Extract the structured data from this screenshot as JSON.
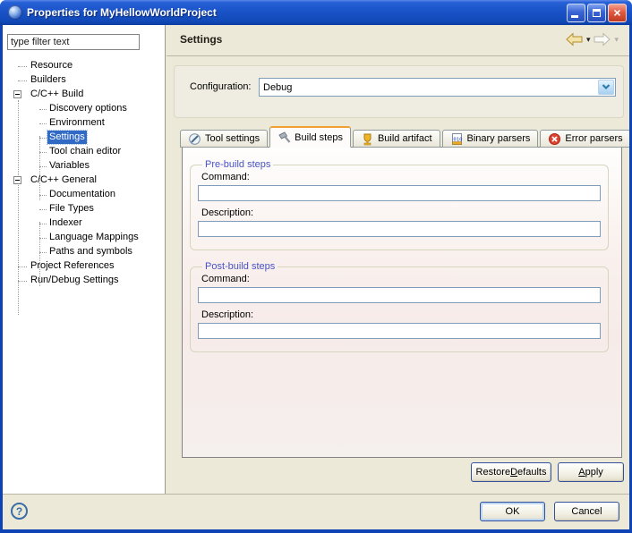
{
  "window": {
    "title": "Properties for MyHellowWorldProject",
    "close_glyph": "×"
  },
  "sidebar": {
    "filter_value": "type filter text",
    "tree": [
      {
        "label": "Resource",
        "level": 0
      },
      {
        "label": "Builders",
        "level": 0
      },
      {
        "label": "C/C++ Build",
        "level": 0,
        "expanded": true
      },
      {
        "label": "Discovery options",
        "level": 1
      },
      {
        "label": "Environment",
        "level": 1
      },
      {
        "label": "Settings",
        "level": 1,
        "selected": true
      },
      {
        "label": "Tool chain editor",
        "level": 1
      },
      {
        "label": "Variables",
        "level": 1
      },
      {
        "label": "C/C++ General",
        "level": 0,
        "expanded": true
      },
      {
        "label": "Documentation",
        "level": 1
      },
      {
        "label": "File Types",
        "level": 1
      },
      {
        "label": "Indexer",
        "level": 1
      },
      {
        "label": "Language Mappings",
        "level": 1
      },
      {
        "label": "Paths and symbols",
        "level": 1
      },
      {
        "label": "Project References",
        "level": 0
      },
      {
        "label": "Run/Debug Settings",
        "level": 0
      }
    ]
  },
  "header": {
    "title": "Settings",
    "back_icon": "back-arrow",
    "forward_icon": "forward-arrow",
    "menu_glyph": "▾"
  },
  "config": {
    "label": "Configuration:",
    "value": "Debug"
  },
  "tabs": [
    {
      "label": "Tool settings",
      "icon": "tool-settings-icon",
      "active": false
    },
    {
      "label": "Build steps",
      "icon": "build-steps-icon",
      "active": true
    },
    {
      "label": "Build artifact",
      "icon": "build-artifact-icon",
      "active": false
    },
    {
      "label": "Binary parsers",
      "icon": "binary-parsers-icon",
      "binary_text": "010",
      "active": false
    },
    {
      "label": "Error parsers",
      "icon": "error-parsers-icon",
      "active": false
    }
  ],
  "build_steps": {
    "pre": {
      "legend": "Pre-build steps",
      "command_label": "Command:",
      "command_value": "",
      "description_label": "Description:",
      "description_value": ""
    },
    "post": {
      "legend": "Post-build steps",
      "command_label": "Command:",
      "command_value": "",
      "description_label": "Description:",
      "description_value": ""
    }
  },
  "actions": {
    "restore_defaults": {
      "pre": "Restore ",
      "accel": "D",
      "post": "efaults"
    },
    "apply": {
      "pre": "",
      "accel": "A",
      "post": "pply"
    },
    "ok": "OK",
    "cancel": "Cancel",
    "help_glyph": "?"
  },
  "colors": {
    "titlebar_blue": "#1a53c8",
    "selection_blue": "#316AC5",
    "active_tab_highlight": "#F0A030",
    "dialog_beige": "#ECE9D8",
    "input_border": "#7F9DB9"
  }
}
